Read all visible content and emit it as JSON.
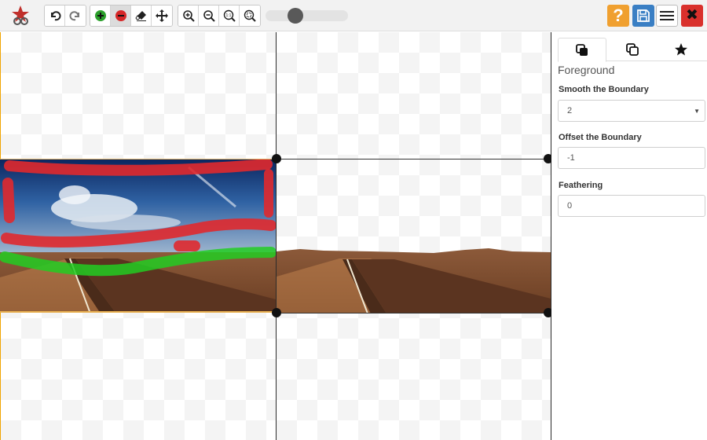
{
  "toolbar": {
    "logo": "app-logo",
    "history_tools": [
      {
        "name": "undo-button",
        "icon": "undo-icon"
      },
      {
        "name": "redo-button",
        "icon": "redo-icon"
      }
    ],
    "mark_tools": [
      {
        "name": "mark-foreground-button",
        "icon": "plus-circle-icon",
        "color": "#2ca02c"
      },
      {
        "name": "mark-background-button",
        "icon": "minus-circle-icon",
        "color": "#d62728",
        "active": true
      },
      {
        "name": "eraser-button",
        "icon": "eraser-icon"
      },
      {
        "name": "move-button",
        "icon": "move-icon"
      }
    ],
    "zoom_tools": [
      {
        "name": "zoom-in-button",
        "icon": "zoom-in-icon"
      },
      {
        "name": "zoom-out-button",
        "icon": "zoom-out-icon"
      },
      {
        "name": "zoom-actual-button",
        "icon": "zoom-1to1-icon",
        "text": "1:1"
      },
      {
        "name": "zoom-fit-button",
        "icon": "zoom-fit-icon"
      }
    ],
    "brush_size_level": 0.33,
    "right_buttons": [
      {
        "name": "help-button",
        "icon": "question-icon",
        "glyph": "?",
        "color": "#f0a030"
      },
      {
        "name": "save-button",
        "icon": "floppy-icon",
        "color": "#3a7fc4"
      },
      {
        "name": "menu-button",
        "icon": "hamburger-icon"
      },
      {
        "name": "close-button",
        "icon": "close-icon",
        "glyph": "✖",
        "color": "#d9302c"
      }
    ]
  },
  "panel": {
    "tabs": [
      {
        "name": "tab-foreground",
        "icon": "layers-filled-icon",
        "active": true
      },
      {
        "name": "tab-copy",
        "icon": "layers-outline-icon",
        "active": false
      },
      {
        "name": "tab-favorites",
        "icon": "star-icon",
        "active": false
      }
    ],
    "title": "Foreground",
    "smooth": {
      "label": "Smooth the Boundary",
      "value": "2"
    },
    "offset": {
      "label": "Offset the Boundary",
      "value": "-1"
    },
    "feathering": {
      "label": "Feathering",
      "value": "0"
    }
  },
  "colors": {
    "foreground_mark": "#22cc22",
    "background_mark": "#e0292e",
    "accent": "#f0a400"
  }
}
